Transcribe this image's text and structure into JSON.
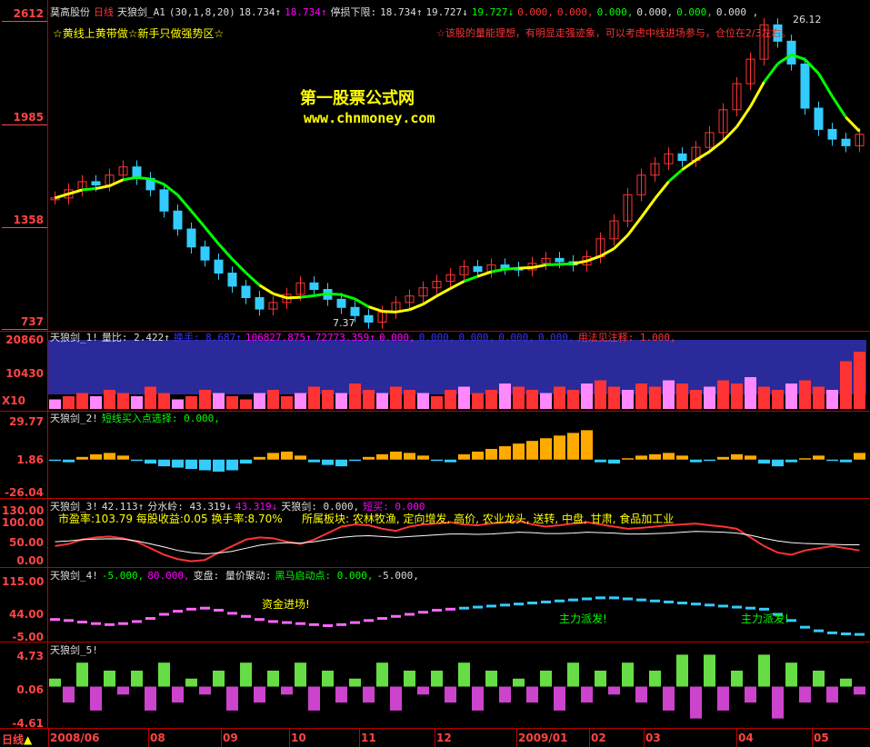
{
  "main": {
    "stock": "莫高股份",
    "period": "日线",
    "formula": "天狼剑_A1",
    "params": "(30,1,8,20)",
    "values": [
      "18.734↑",
      "18.734↑"
    ],
    "stop_label": "停损下限:",
    "stop_values": [
      "18.734↑",
      "19.727↓",
      "19.727↓",
      "0.000,",
      "0.000,",
      "0.000,",
      "0.000,",
      "0.000,",
      "0.000 ,"
    ],
    "tip_left": "☆黄线上黄带做☆新手只做强势区☆",
    "tip_right": "☆该股的量能理想，有明显走强迹象，可以考虑中线进场参与，仓位在2/3左右。",
    "watermark_title": "第一股票公式网",
    "watermark_url": "www.chnmoney.com",
    "y_ticks": [
      "2612",
      "1985",
      "1358",
      "737"
    ],
    "high_label": "26.12",
    "low_label": "7.37",
    "chart_data": {
      "type": "candlestick",
      "y_range": [
        7.37,
        26.12
      ],
      "y_ticks": [
        26.12,
        19.85,
        13.58,
        7.37
      ],
      "close_series": [
        15.0,
        15.5,
        16.0,
        15.8,
        16.4,
        16.9,
        16.2,
        15.5,
        14.2,
        13.1,
        12.0,
        11.2,
        10.4,
        9.6,
        8.9,
        8.2,
        8.6,
        9.1,
        9.8,
        9.4,
        8.8,
        8.3,
        7.8,
        7.4,
        8.0,
        8.6,
        9.0,
        9.5,
        9.9,
        10.3,
        10.8,
        10.5,
        10.9,
        10.7,
        10.6,
        11.0,
        11.3,
        11.1,
        10.9,
        11.4,
        12.5,
        13.6,
        15.2,
        16.4,
        17.1,
        17.7,
        17.3,
        18.1,
        19.0,
        20.4,
        22.0,
        23.5,
        25.6,
        24.6,
        23.2,
        20.5,
        19.2,
        18.6,
        18.2,
        18.9
      ]
    }
  },
  "vol": {
    "title": "天狼剑_1!",
    "items": [
      "量比: 2.422↑",
      "换手: 8.687↑",
      "106827.875↑",
      "72773.359↑",
      "0.000,",
      "0.000,",
      "0.000,",
      "0.000,",
      "0.000,",
      "用法见注释: 1.000,"
    ],
    "y_ticks": [
      "20860",
      "10430",
      "X10"
    ],
    "chart_data": {
      "type": "bar",
      "values": [
        3,
        4,
        5,
        4,
        6,
        5,
        4,
        7,
        5,
        3,
        4,
        6,
        5,
        4,
        3,
        5,
        6,
        4,
        5,
        7,
        6,
        5,
        8,
        6,
        5,
        7,
        6,
        5,
        4,
        6,
        7,
        5,
        6,
        8,
        7,
        6,
        5,
        7,
        6,
        8,
        9,
        7,
        6,
        8,
        7,
        9,
        8,
        6,
        7,
        9,
        8,
        10,
        7,
        6,
        8,
        9,
        7,
        6,
        15,
        18
      ],
      "ylim": [
        0,
        20860
      ]
    }
  },
  "p2": {
    "title": "天狼剑_2!",
    "label": "短线买入点选择: 0.000,",
    "y_ticks": [
      "29.77",
      "1.86",
      "-26.04"
    ],
    "chart_data": {
      "type": "bar",
      "values": [
        -1,
        -2,
        2,
        4,
        5,
        3,
        -1,
        -3,
        -5,
        -6,
        -7,
        -8,
        -9,
        -8,
        -3,
        2,
        5,
        6,
        3,
        -2,
        -4,
        -5,
        -1,
        2,
        4,
        6,
        5,
        3,
        -1,
        -2,
        4,
        6,
        8,
        10,
        12,
        14,
        16,
        18,
        20,
        22,
        -2,
        -3,
        1,
        3,
        4,
        5,
        3,
        -2,
        -1,
        2,
        4,
        3,
        -3,
        -5,
        -2,
        1,
        3,
        -1,
        -2,
        5
      ],
      "ylim": [
        -26.04,
        29.77
      ]
    }
  },
  "p3": {
    "title": "天狼剑_3!",
    "items": [
      "42.113↑",
      "分水岭: 43.319↓",
      "43.319↓",
      "天狼剑: 0.000,",
      "短买: 0.000"
    ],
    "info": [
      "市盈率:103.79",
      "每股收益:0.05",
      "换手率:8.70%"
    ],
    "sector": "所属板块: 农林牧渔, 定向增发, 高价, 农业龙头, 送转, 中盘, 甘肃, 食品加工业",
    "y_ticks": [
      "130.00",
      "100.00",
      "50.00",
      "0.00"
    ],
    "chart_data": {
      "type": "line",
      "series": [
        {
          "values": [
            40,
            45,
            55,
            60,
            62,
            58,
            50,
            35,
            20,
            10,
            5,
            8,
            25,
            40,
            55,
            60,
            58,
            50,
            45,
            55,
            70,
            85,
            90,
            88,
            80,
            75,
            85,
            90,
            92,
            95,
            90,
            88,
            92,
            95,
            98,
            90,
            85,
            88,
            92,
            95,
            90,
            85,
            80,
            82,
            85,
            88,
            90,
            92,
            88,
            85,
            80,
            60,
            40,
            25,
            20,
            30,
            35,
            40,
            35,
            30
          ]
        },
        {
          "values": [
            50,
            52,
            55,
            56,
            57,
            56,
            52,
            45,
            38,
            30,
            25,
            22,
            24,
            28,
            35,
            42,
            46,
            48,
            47,
            50,
            55,
            60,
            63,
            64,
            62,
            60,
            62,
            64,
            66,
            68,
            68,
            67,
            68,
            70,
            72,
            71,
            69,
            69,
            70,
            72,
            71,
            70,
            68,
            68,
            69,
            70,
            72,
            74,
            73,
            72,
            70,
            65,
            58,
            52,
            48,
            46,
            45,
            44,
            43,
            43
          ]
        }
      ],
      "ylim": [
        0,
        130
      ]
    }
  },
  "p4": {
    "title": "天狼剑_4!",
    "items": [
      "-5.000,",
      "80.000,",
      "变盘: 量价聚动:",
      "黑马启动点: 0.000,",
      "-5.000,"
    ],
    "notes": [
      "资金进场!",
      "主力派发!",
      "主力派发!"
    ],
    "y_ticks": [
      "115.00",
      "44.00",
      "-5.00"
    ],
    "chart_data": {
      "type": "line",
      "series": [
        {
          "values": [
            30,
            28,
            25,
            22,
            20,
            22,
            26,
            32,
            40,
            46,
            50,
            52,
            48,
            42,
            36,
            30,
            26,
            24,
            22,
            20,
            18,
            20,
            24,
            28,
            32,
            36,
            40,
            44,
            48,
            50,
            52,
            54,
            56,
            58,
            60,
            62,
            64,
            66,
            68,
            70,
            72,
            72,
            70,
            68,
            66,
            64,
            62,
            60,
            58,
            56,
            54,
            52,
            50,
            40,
            28,
            15,
            8,
            4,
            2,
            1
          ]
        }
      ],
      "ylim": [
        -5,
        115
      ]
    }
  },
  "p5": {
    "title": "天狼剑_5!",
    "y_ticks": [
      "4.73",
      "0.06",
      "-4.61"
    ],
    "chart_data": {
      "type": "bar",
      "values": [
        1,
        -2,
        3,
        -3,
        2,
        -1,
        2,
        -3,
        3,
        -2,
        1,
        -1,
        2,
        -3,
        3,
        -2,
        2,
        -1,
        3,
        -3,
        2,
        -2,
        1,
        -2,
        3,
        -3,
        2,
        -1,
        2,
        -2,
        3,
        -3,
        2,
        -2,
        1,
        -2,
        2,
        -3,
        3,
        -2,
        2,
        -1,
        3,
        -2,
        2,
        -3,
        4,
        -4,
        4,
        -3,
        2,
        -2,
        4,
        -4,
        3,
        -2,
        2,
        -2,
        1,
        -1
      ],
      "ylim": [
        -4.61,
        4.73
      ]
    }
  },
  "xaxis": {
    "period": "日线",
    "months": [
      "2008/06",
      "08",
      "09",
      "10",
      "11",
      "12",
      "2009/01",
      "02",
      "03",
      "04",
      "05"
    ]
  },
  "colors": {
    "up": "#ff3333",
    "down": "#33ccff",
    "ma_yellow": "#ffff00",
    "ma_green": "#00ff00",
    "grid": "#b00000"
  }
}
